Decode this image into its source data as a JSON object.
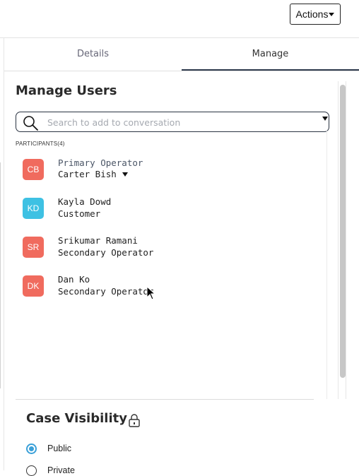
{
  "header": {
    "actions_label": "Actions"
  },
  "tabs": [
    {
      "label": "Details"
    },
    {
      "label": "Manage"
    }
  ],
  "manage_users": {
    "title": "Manage Users",
    "search_placeholder": "Search to add to conversation",
    "participants_label": "PARTICIPANTS(4)",
    "participants": [
      {
        "initials": "CB",
        "color": "#f06b5e",
        "line1": "Primary Operator",
        "line2": "Carter Bish"
      },
      {
        "initials": "KD",
        "color": "#3ec1e3",
        "line1": "Kayla Dowd",
        "line2": "Customer"
      },
      {
        "initials": "SR",
        "color": "#f06b5e",
        "line1": "Srikumar Ramani",
        "line2": "Secondary Operator"
      },
      {
        "initials": "DK",
        "color": "#f06b5e",
        "line1": "Dan Ko",
        "line2": "Secondary Operator"
      }
    ]
  },
  "case_visibility": {
    "title": "Case Visibility",
    "icon": "lock-icon",
    "options": [
      {
        "label": "Public",
        "checked": true
      },
      {
        "label": "Private",
        "checked": false
      }
    ]
  },
  "colors": {
    "accent": "#3aa0d8",
    "tab_underline": "#2e3a4d"
  }
}
